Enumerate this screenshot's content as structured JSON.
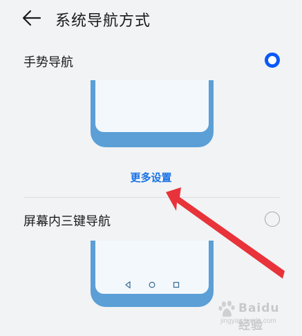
{
  "header": {
    "title": "系统导航方式",
    "back_icon": "back-arrow-icon"
  },
  "options": [
    {
      "label": "手势导航",
      "selected": true
    },
    {
      "label": "屏幕内三键导航",
      "selected": false
    }
  ],
  "more_settings": {
    "label": "更多设置"
  },
  "colors": {
    "accent": "#0a59f7",
    "link": "#1772e6",
    "phone_frame": "#5b9fd6",
    "annotation_arrow": "#e8333a"
  },
  "nav_keys_icons": [
    "back-triangle-icon",
    "home-circle-icon",
    "recent-square-icon"
  ],
  "watermark": {
    "text": "Baidu经验",
    "sub": "jingyan.baidu.com"
  }
}
